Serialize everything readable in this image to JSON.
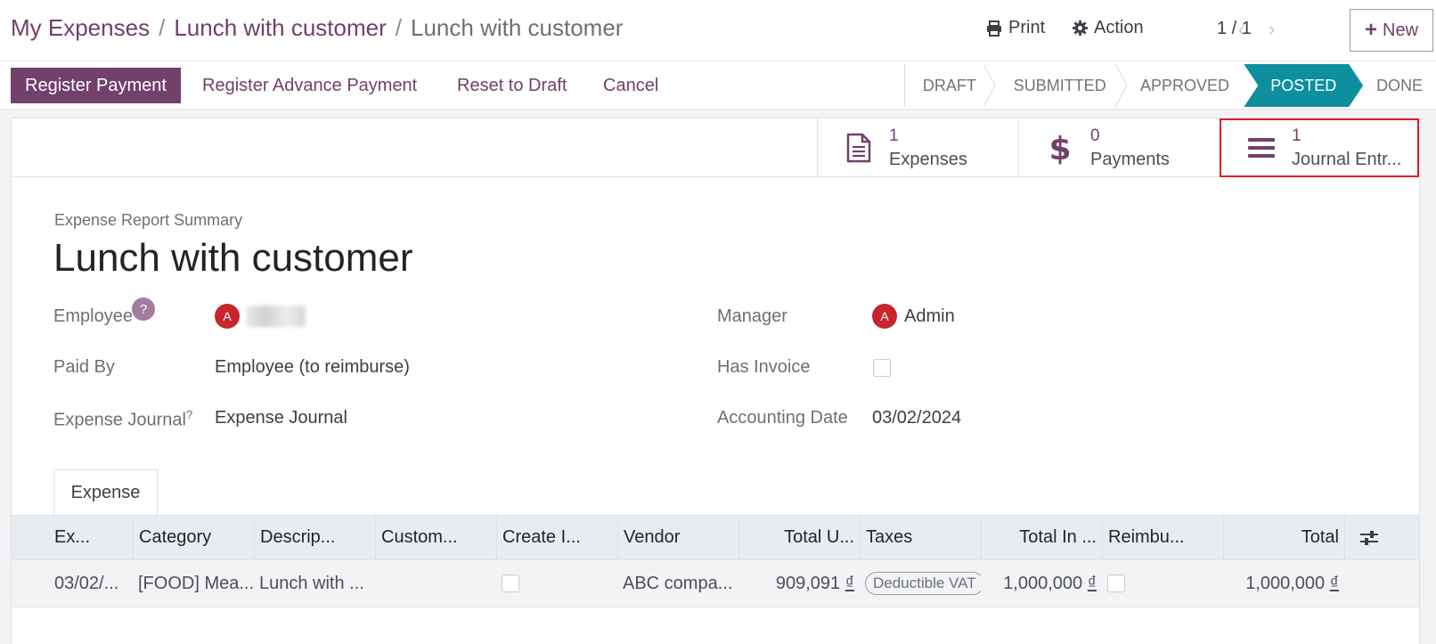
{
  "breadcrumb": {
    "items": [
      "My Expenses",
      "Lunch with customer"
    ],
    "separator": "/",
    "current": "Lunch with customer"
  },
  "toolbar": {
    "print_label": "Print",
    "action_label": "Action",
    "pager": "1 / 1",
    "new_label": "New"
  },
  "actions": {
    "register_payment": "Register Payment",
    "register_advance_payment": "Register Advance Payment",
    "reset_to_draft": "Reset to Draft",
    "cancel": "Cancel"
  },
  "stages": [
    "DRAFT",
    "SUBMITTED",
    "APPROVED",
    "POSTED",
    "DONE"
  ],
  "active_stage": "POSTED",
  "smart_buttons": [
    {
      "count": "1",
      "label": "Expenses",
      "icon": "document-icon"
    },
    {
      "count": "0",
      "label": "Payments",
      "icon": "dollar-icon"
    },
    {
      "count": "1",
      "label": "Journal Entr...",
      "icon": "bars-icon"
    }
  ],
  "form": {
    "summary_label": "Expense Report Summary",
    "title": "Lunch with customer",
    "employee_label": "Employee",
    "employee_help": "?",
    "employee_avatar": "A",
    "paid_by_label": "Paid By",
    "paid_by_value": "Employee (to reimburse)",
    "journal_label": "Expense Journal",
    "journal_help": "?",
    "journal_value": "Expense Journal",
    "manager_label": "Manager",
    "manager_avatar": "A",
    "manager_value": "Admin",
    "has_invoice_label": "Has Invoice",
    "has_invoice_checked": false,
    "accounting_date_label": "Accounting Date",
    "accounting_date_value": "03/02/2024"
  },
  "tabs": [
    "Expense"
  ],
  "table": {
    "headers": [
      "Ex...",
      "Category",
      "Descrip...",
      "Custom...",
      "Create I...",
      "Vendor",
      "Total U...",
      "Taxes",
      "Total In ...",
      "Reimbu...",
      "Total"
    ],
    "rows": [
      {
        "date": "03/02/...",
        "category": "[FOOD] Mea...",
        "description": "Lunch with ...",
        "customer": "",
        "create_invoice": false,
        "vendor": "ABC compa...",
        "total_untaxed": "909,091",
        "taxes": "Deductible VAT",
        "total_incl": "1,000,000",
        "reimbursed": false,
        "total": "1,000,000",
        "currency": "₫"
      }
    ]
  },
  "colors": {
    "brand": "#71406b",
    "active_stage": "#0e8f9e",
    "highlight": "#e01b24",
    "avatar": "#c8252d"
  }
}
